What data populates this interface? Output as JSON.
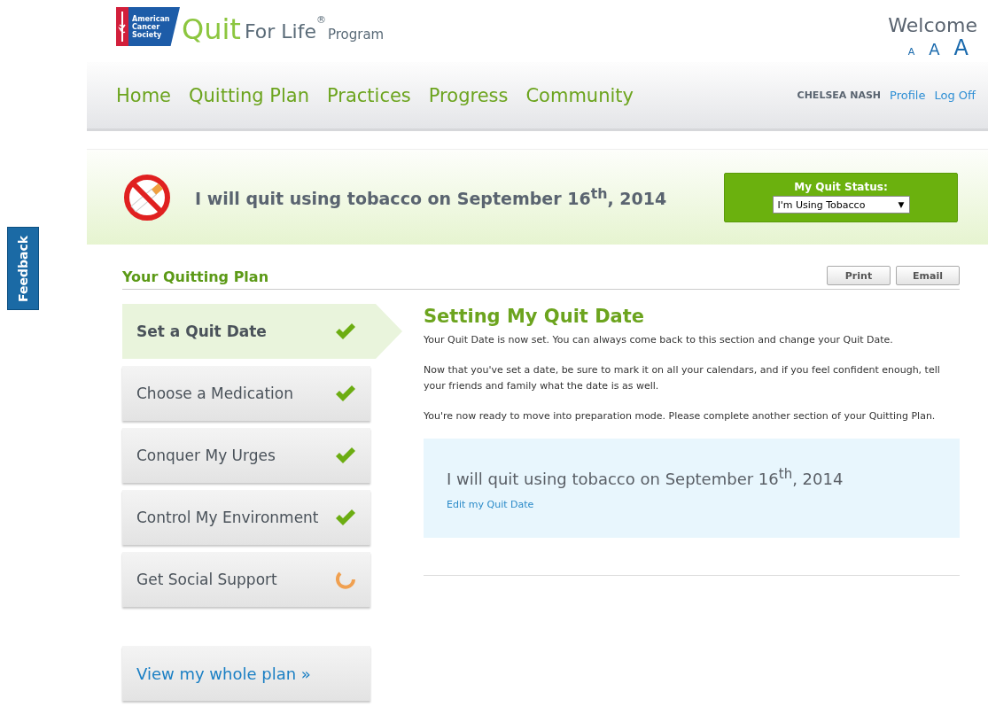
{
  "feedback_tab": {
    "label": "Feedback"
  },
  "logo": {
    "org_lines": [
      "American",
      "Cancer",
      "Society"
    ],
    "quit": "Quit",
    "for_life": "For Life",
    "registered": "®",
    "program": "Program"
  },
  "welcome": {
    "title": "Welcome",
    "text_sizes": [
      "A",
      "A",
      "A"
    ]
  },
  "nav": {
    "items": [
      {
        "label": "Home",
        "selected": false
      },
      {
        "label": "Quitting Plan",
        "selected": false
      },
      {
        "label": "Practices",
        "selected": false
      },
      {
        "label": "Progress",
        "selected": false
      },
      {
        "label": "Community",
        "selected": false
      }
    ],
    "user_name": "CHELSEA NASH",
    "links": [
      "Profile",
      "Log Off"
    ]
  },
  "banner": {
    "headline": "I will quit using tobacco on September 16$^{th}$, 2014",
    "quit_status": {
      "label": "My Quit Status:",
      "value": "I'm Using Tobacco",
      "caret": "▼"
    }
  },
  "plan": {
    "title": "Your Quitting Plan",
    "buttons": [
      "Print",
      "Email"
    ],
    "steps": [
      {
        "label": "Set a Quit Date",
        "completed": true,
        "selected": true
      },
      {
        "label": "Choose a Medication",
        "completed": true,
        "selected": false
      },
      {
        "label": "Conquer My Urges",
        "completed": true,
        "selected": false
      },
      {
        "label": "Control My Environment",
        "completed": true,
        "selected": false
      },
      {
        "label": "Get Social Support",
        "completed": false,
        "selected": false
      }
    ],
    "view_all": "View my whole plan »"
  },
  "content": {
    "heading": "Setting My Quit Date",
    "paragraphs": [
      "Your Quit Date is now set. You can always come back to this section and change your Quit Date.",
      "Now that you've set a date, be sure to mark it on all your calendars, and if you feel confident enough, tell your friends and family what the date is as well.",
      "You're now ready to move into preparation mode. Please complete another section of your Quitting Plan."
    ],
    "date_box": {
      "text": "I will quit using tobacco on September 16$^{th}$, 2014",
      "link": "Edit my Quit Date"
    }
  }
}
